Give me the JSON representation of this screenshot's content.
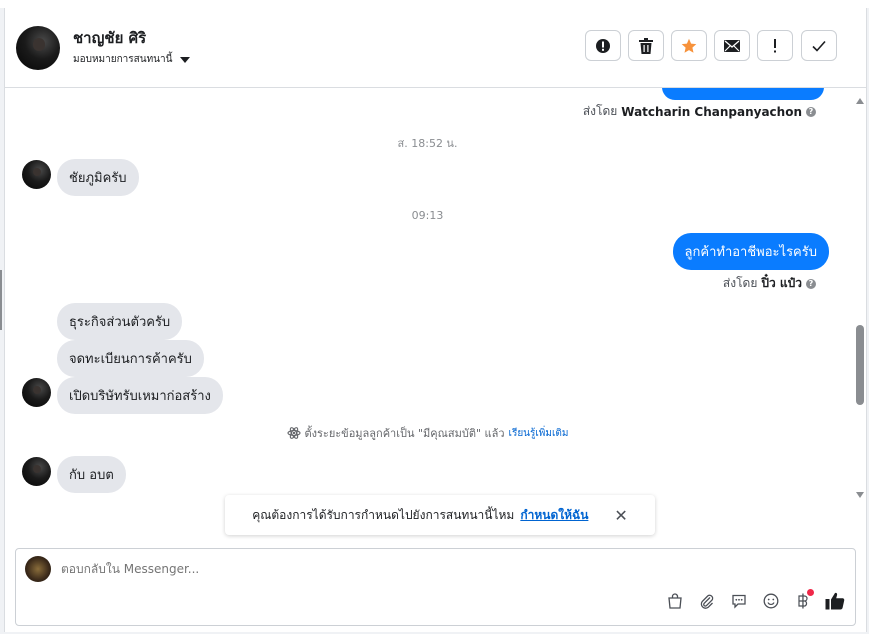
{
  "header": {
    "name": "ชาญชัย ศิริ",
    "assign": "มอบหมายการสนทนานี้",
    "actions": [
      "spam-icon",
      "trash-icon",
      "star-icon",
      "mail-icon",
      "important-icon",
      "check-icon"
    ]
  },
  "messages": {
    "first_sent_by_label": "ส่งโดย",
    "first_sent_by_name": "Watcharin Chanpanyachon",
    "time1": "ส. 18:52 น.",
    "msg1": "ชัยภูมิครับ",
    "time2": "09:13",
    "out1": "ลูกค้าทำอาชีพอะไรครับ",
    "second_sent_by_label": "ส่งโดย",
    "second_sent_by_name": "ปิ๋ว แป๋ว",
    "msg2": "ธุระกิจส่วนตัวครับ",
    "msg3": "จดทะเบียนการค้าครับ",
    "msg4": "เปิดบริษัทรับเหมาก่อสร้าง",
    "notice": "ตั้งระยะข้อมูลลูกค้าเป็น \"มีคุณสมบัติ\" แล้ว",
    "notice_link": "เรียนรู้เพิ่มเติม",
    "msg5": "กับ  อบต"
  },
  "toast": {
    "text": "คุณต้องการได้รับการกำหนดไปยังการสนทนานี้ไหม",
    "link": "กำหนดให้ฉัน",
    "close": "✕"
  },
  "composer": {
    "placeholder": "ตอบกลับใน Messenger..."
  },
  "colors": {
    "accent": "#0a7cff",
    "star": "#f7923b"
  }
}
